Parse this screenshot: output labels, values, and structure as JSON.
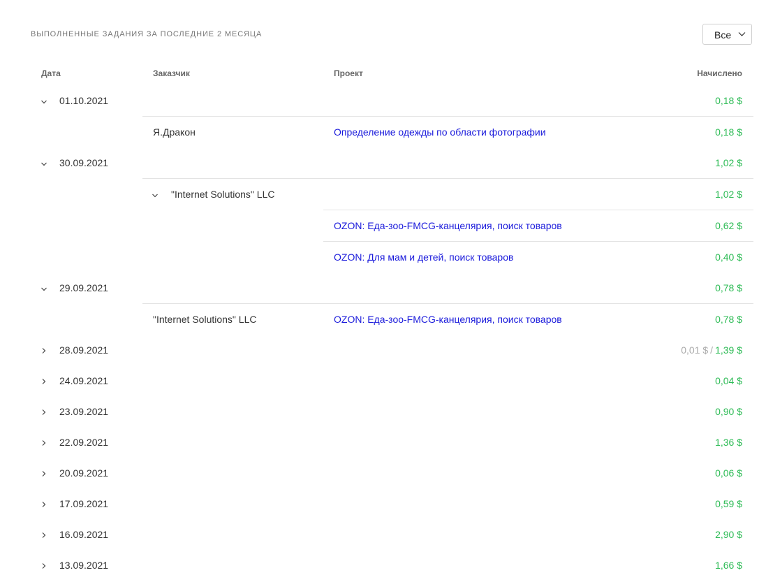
{
  "title": "ВЫПОЛНЕННЫЕ ЗАДАНИЯ ЗА ПОСЛЕДНИЕ 2 МЕСЯЦА",
  "filter": {
    "value": "Все",
    "icon": "chevron-down-icon"
  },
  "columns": {
    "date": "Дата",
    "customer": "Заказчик",
    "project": "Проект",
    "amount": "Начислено"
  },
  "rows": [
    {
      "kind": "date",
      "expanded": true,
      "date": "01.10.2021",
      "amount": "0,18 $"
    },
    {
      "kind": "task",
      "customer": "Я.Дракон",
      "project": "Определение одежды по области фотографии",
      "amount": "0,18 $"
    },
    {
      "kind": "date",
      "expanded": true,
      "date": "30.09.2021",
      "amount": "1,02 $"
    },
    {
      "kind": "customer-group",
      "expanded": true,
      "customer": "\"Internet Solutions\" LLC",
      "amount": "1,02 $"
    },
    {
      "kind": "project",
      "project": "OZON: Еда-зоо-FMCG-канцелярия, поиск товаров",
      "amount": "0,62 $"
    },
    {
      "kind": "project",
      "project": "OZON: Для мам и детей, поиск товаров",
      "amount": "0,40 $"
    },
    {
      "kind": "date",
      "expanded": true,
      "date": "29.09.2021",
      "amount": "0,78 $"
    },
    {
      "kind": "task",
      "customer": "\"Internet Solutions\" LLC",
      "project": "OZON: Еда-зоо-FMCG-канцелярия, поиск товаров",
      "amount": "0,78 $"
    },
    {
      "kind": "date",
      "expanded": false,
      "date": "28.09.2021",
      "pending": "0,01 $",
      "separator": "/",
      "amount": "1,39 $"
    },
    {
      "kind": "date",
      "expanded": false,
      "date": "24.09.2021",
      "amount": "0,04 $"
    },
    {
      "kind": "date",
      "expanded": false,
      "date": "23.09.2021",
      "amount": "0,90 $"
    },
    {
      "kind": "date",
      "expanded": false,
      "date": "22.09.2021",
      "amount": "1,36 $"
    },
    {
      "kind": "date",
      "expanded": false,
      "date": "20.09.2021",
      "amount": "0,06 $"
    },
    {
      "kind": "date",
      "expanded": false,
      "date": "17.09.2021",
      "amount": "0,59 $"
    },
    {
      "kind": "date",
      "expanded": false,
      "date": "16.09.2021",
      "amount": "2,90 $"
    },
    {
      "kind": "date",
      "expanded": false,
      "date": "13.09.2021",
      "amount": "1,66 $"
    }
  ],
  "colors": {
    "amount": "#2dbb55",
    "link": "#1a1adb",
    "pending": "#aaaaaa"
  }
}
